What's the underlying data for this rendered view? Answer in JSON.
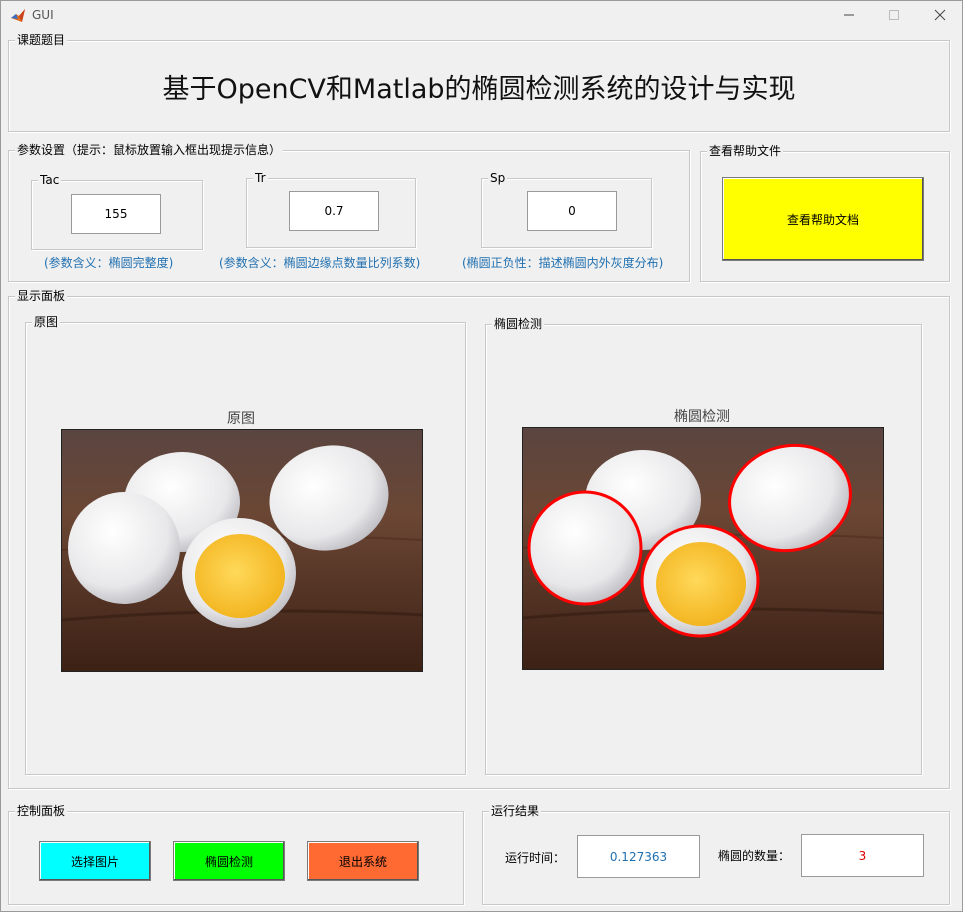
{
  "window": {
    "title": "GUI"
  },
  "topic": {
    "legend": "课题题目",
    "title": "基于OpenCV和Matlab的椭圆检测系统的设计与实现"
  },
  "params": {
    "legend": "参数设置（提示：鼠标放置输入框出现提示信息）",
    "tac": {
      "label": "Tac",
      "value": "155",
      "hint": "(参数含义：椭圆完整度)"
    },
    "tr": {
      "label": "Tr",
      "value": "0.7",
      "hint": "(参数含义：椭圆边缘点数量比列系数)"
    },
    "sp": {
      "label": "Sp",
      "value": "0",
      "hint": "(椭圆正负性：描述椭圆内外灰度分布)"
    }
  },
  "help": {
    "legend": "查看帮助文件",
    "button": "查看帮助文档",
    "button_color": "#ffff00"
  },
  "display": {
    "legend": "显示面板",
    "original": {
      "legend": "原图",
      "title": "原图"
    },
    "detect": {
      "legend": "椭圆检测",
      "title": "椭圆检测"
    }
  },
  "control": {
    "legend": "控制面板",
    "select_button": "选择图片",
    "select_color": "#00ffff",
    "detect_button": "椭圆检测",
    "detect_color": "#00ff00",
    "exit_button": "退出系统",
    "exit_color": "#ff6a33"
  },
  "results": {
    "legend": "运行结果",
    "time_label": "运行时间：",
    "time_value": "0.127363",
    "count_label": "椭圆的数量：",
    "count_value": "3",
    "time_color": "#1f6fb0",
    "count_color": "#e00000"
  },
  "icons": [
    "matlab-icon",
    "minimize-icon",
    "maximize-icon",
    "close-icon"
  ]
}
